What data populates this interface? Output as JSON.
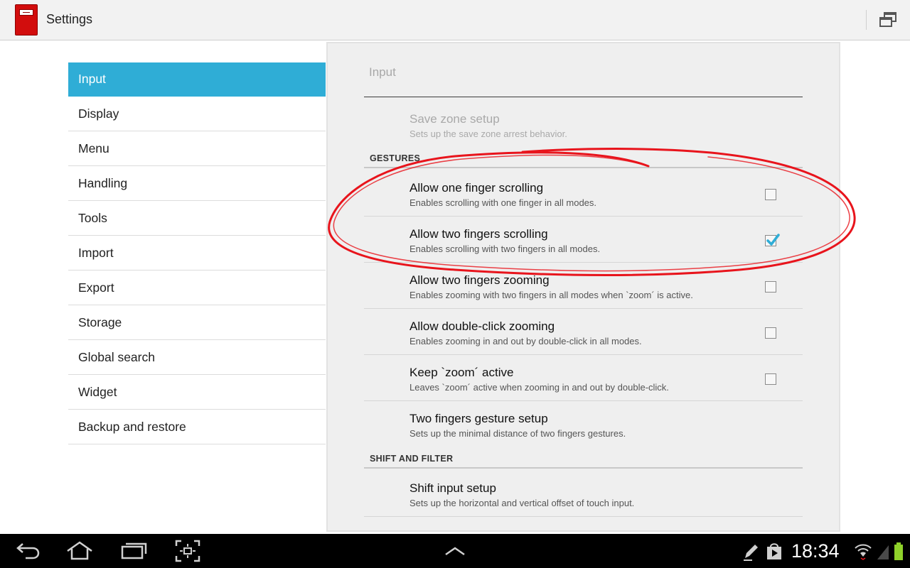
{
  "app": {
    "title": "Settings",
    "brand_color": "#d20d0d"
  },
  "sidebar": {
    "accent": "#2fadd6",
    "items": [
      {
        "label": "Input"
      },
      {
        "label": "Display"
      },
      {
        "label": "Menu"
      },
      {
        "label": "Handling"
      },
      {
        "label": "Tools"
      },
      {
        "label": "Import"
      },
      {
        "label": "Export"
      },
      {
        "label": "Storage"
      },
      {
        "label": "Global search"
      },
      {
        "label": "Widget"
      },
      {
        "label": "Backup and restore"
      }
    ]
  },
  "panel": {
    "header": "Input",
    "save_zone": {
      "title": "Save zone setup",
      "summary": "Sets up the save zone arrest behavior.",
      "enabled": false
    },
    "gestures_label": "GESTURES",
    "gestures": [
      {
        "title": "Allow one finger scrolling",
        "summary": "Enables scrolling with one finger in all modes.",
        "checked": false
      },
      {
        "title": "Allow two fingers scrolling",
        "summary": "Enables scrolling with two fingers in all modes.",
        "checked": true
      },
      {
        "title": "Allow two fingers zooming",
        "summary": "Enables zooming with two fingers in all modes when `zoom´ is active.",
        "checked": false
      },
      {
        "title": "Allow double-click zooming",
        "summary": "Enables zooming in and out by double-click in all modes.",
        "checked": false
      },
      {
        "title": "Keep `zoom´ active",
        "summary": "Leaves `zoom´ active when zooming in and out by double-click.",
        "checked": false
      }
    ],
    "two_fingers_setup": {
      "title": "Two fingers gesture setup",
      "summary": "Sets up the minimal distance of two fingers gestures."
    },
    "shift_label": "SHIFT AND FILTER",
    "shift_setup": {
      "title": "Shift input setup",
      "summary": "Sets up the horizontal and vertical offset of touch input."
    }
  },
  "annotation_color": "#e8141c",
  "status": {
    "time": "18:34",
    "icons": [
      "back-icon",
      "home-icon",
      "recent-apps-icon",
      "screenshot-icon",
      "up-chevron-icon",
      "pen-icon",
      "play-store-icon",
      "wifi-icon",
      "signal-icon",
      "battery-icon"
    ]
  }
}
